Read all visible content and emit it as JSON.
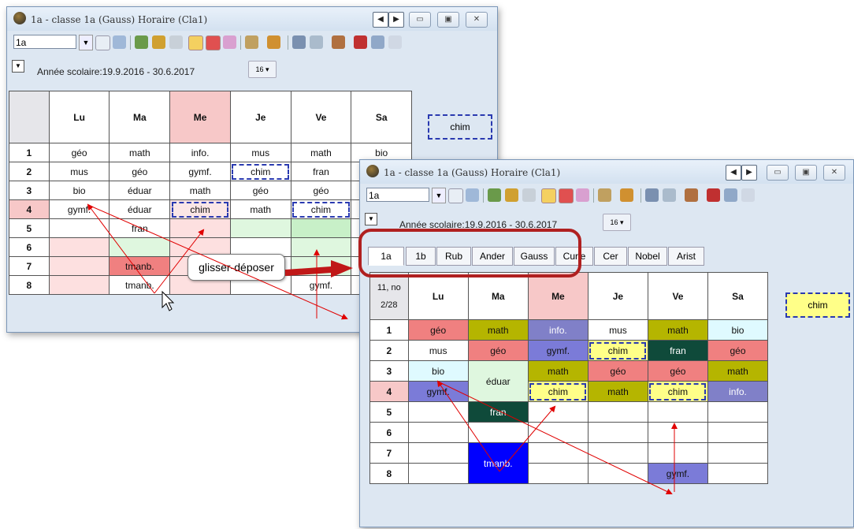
{
  "window1": {
    "title": "1a - classe 1a (Gauss)  Horaire  (Cla1)",
    "class_select": "1a",
    "school_year": "Année scolaire:19.9.2016 - 30.6.2017",
    "legend": "chim",
    "days": [
      "Lu",
      "Ma",
      "Me",
      "Je",
      "Ve",
      "Sa"
    ],
    "periods": [
      "1",
      "2",
      "3",
      "4",
      "5",
      "6",
      "7",
      "8"
    ],
    "rows": [
      [
        "géo",
        "math",
        "info.",
        "mus",
        "math",
        "bio"
      ],
      [
        "mus",
        "géo",
        "gymf.",
        "chim",
        "fran",
        ""
      ],
      [
        "bio",
        "éduar",
        "math",
        "géo",
        "géo",
        ""
      ],
      [
        "gymf.",
        "éduar",
        "chim",
        "math",
        "chim",
        ""
      ],
      [
        "",
        "fran",
        "",
        "",
        "",
        ""
      ],
      [
        "",
        "",
        "",
        "",
        "",
        ""
      ],
      [
        "",
        "tmanb.",
        "",
        "",
        "",
        ""
      ],
      [
        "",
        "tmanb.",
        "",
        "",
        "gymf.",
        ""
      ]
    ]
  },
  "window2": {
    "title": "1a - classe 1a (Gauss)  Horaire  (Cla1)",
    "class_select": "1a",
    "school_year": "Année scolaire:19.9.2016 - 30.6.2017",
    "corner_top": "11, no",
    "corner_page": "2/28",
    "legend": "chim",
    "tabs": [
      "1a",
      "1b",
      "Rub",
      "Ander",
      "Gauss",
      "Curie",
      "Cer",
      "Nobel",
      "Arist"
    ],
    "days": [
      "Lu",
      "Ma",
      "Me",
      "Je",
      "Ve",
      "Sa"
    ],
    "periods": [
      "1",
      "2",
      "3",
      "4",
      "5",
      "6",
      "7",
      "8"
    ],
    "rows": [
      [
        "géo",
        "math",
        "info.",
        "mus",
        "math",
        "bio"
      ],
      [
        "mus",
        "géo",
        "gymf.",
        "chim",
        "fran",
        "géo"
      ],
      [
        "bio",
        "éduar",
        "math",
        "géo",
        "géo",
        "math"
      ],
      [
        "gymf.",
        "",
        "chim",
        "math",
        "chim",
        "info."
      ],
      [
        "",
        "fran",
        "",
        "",
        "",
        ""
      ],
      [
        "",
        "",
        "",
        "",
        "",
        ""
      ],
      [
        "",
        "tmanb.",
        "",
        "",
        "",
        ""
      ],
      [
        "",
        "",
        "",
        "",
        "gymf.",
        ""
      ]
    ]
  },
  "callout": "glisser-déposer",
  "colors": {
    "geo": "#f08080",
    "math": "#b5b500",
    "info": "#8080c8",
    "chim": "#ffff88",
    "fran": "#0f4a3a",
    "bio": "#dffaff",
    "gymf": "#7b7bd8",
    "tmanb": "#0000ff",
    "eduar": "#dff7df",
    "highlight": "#b02020"
  }
}
